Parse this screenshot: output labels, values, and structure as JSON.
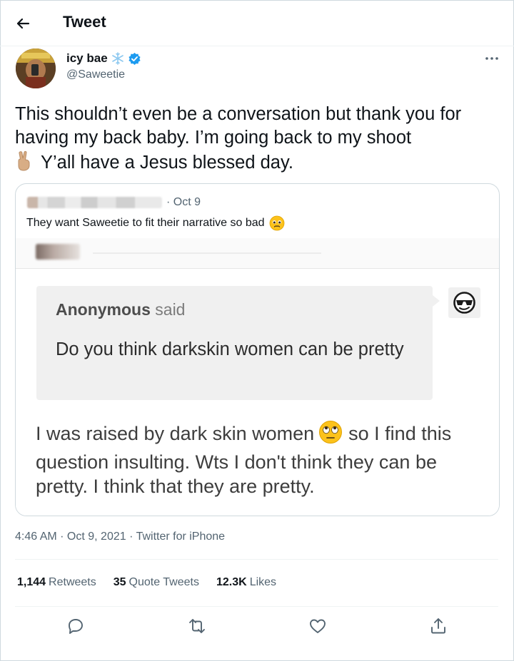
{
  "header": {
    "title": "Tweet",
    "back_icon": "arrow-left-icon"
  },
  "author": {
    "name": "icy bae",
    "name_emoji": "snowflake-icon",
    "verified_icon": "verified-badge-icon",
    "handle": "@Saweetie"
  },
  "tweet": {
    "text_line1": "This shouldn’t even be a conversation but thank you for having my back baby. I’m going back to my shoot",
    "emoji": "victory-hand-icon",
    "text_line2": "Y’all have a Jesus blessed day."
  },
  "quote": {
    "date": "· Oct 9",
    "text": "They want Saweetie to fit their narrative so bad",
    "text_emoji": "pleading-face-icon",
    "media": {
      "asker_name": "Anonymous",
      "asker_suffix": " said",
      "question": "Do you think darkskin women can be pretty",
      "answer_part1": "I was raised by dark skin women",
      "answer_emoji": "eye-roll-face-icon",
      "answer_part2": "so I find this question insulting. Wts I don't think they can be pretty. I think that they are pretty."
    }
  },
  "meta": {
    "timestamp": "4:46 AM · Oct 9, 2021 · Twitter for iPhone"
  },
  "stats": {
    "retweets_count": "1,144",
    "retweets_label": "Retweets",
    "quotes_count": "35",
    "quotes_label": "Quote Tweets",
    "likes_count": "12.3K",
    "likes_label": "Likes"
  },
  "actions": [
    "reply-icon",
    "retweet-icon",
    "like-icon",
    "share-icon"
  ],
  "colors": {
    "accent": "#1d9bf0",
    "text": "#0f1419",
    "secondary": "#536471",
    "border": "#cfd9de"
  }
}
